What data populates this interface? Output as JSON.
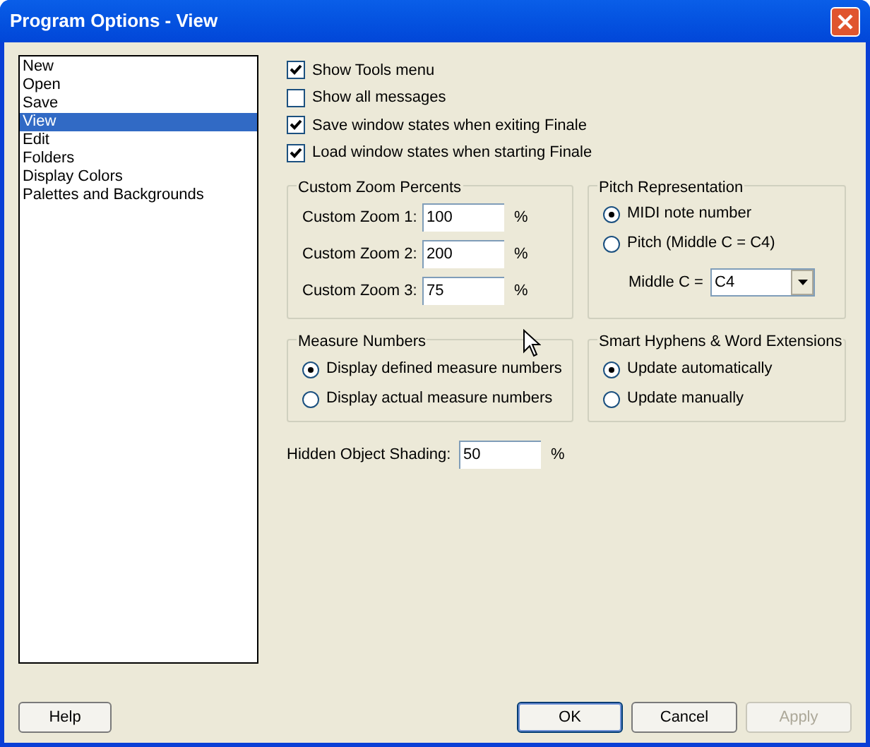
{
  "window": {
    "title": "Program Options - View"
  },
  "list": {
    "items": [
      {
        "label": "New",
        "selected": false
      },
      {
        "label": "Open",
        "selected": false
      },
      {
        "label": "Save",
        "selected": false
      },
      {
        "label": "View",
        "selected": true
      },
      {
        "label": "Edit",
        "selected": false
      },
      {
        "label": "Folders",
        "selected": false
      },
      {
        "label": "Display Colors",
        "selected": false
      },
      {
        "label": "Palettes and Backgrounds",
        "selected": false
      }
    ]
  },
  "checkboxes": [
    {
      "label": "Show Tools menu",
      "checked": true
    },
    {
      "label": "Show all messages",
      "checked": false
    },
    {
      "label": "Save window states when exiting Finale",
      "checked": true
    },
    {
      "label": "Load window states when starting Finale",
      "checked": true
    }
  ],
  "custom_zoom": {
    "title": "Custom Zoom Percents",
    "rows": [
      {
        "label": "Custom Zoom 1:",
        "value": "100",
        "unit": "%"
      },
      {
        "label": "Custom Zoom 2:",
        "value": "200",
        "unit": "%"
      },
      {
        "label": "Custom Zoom 3:",
        "value": "75",
        "unit": "%"
      }
    ]
  },
  "pitch_representation": {
    "title": "Pitch Representation",
    "options": [
      {
        "label": "MIDI note number",
        "selected": true
      },
      {
        "label": "Pitch (Middle C = C4)",
        "selected": false
      }
    ],
    "middle_c": {
      "label": "Middle C =",
      "value": "C4"
    }
  },
  "measure_numbers": {
    "title": "Measure Numbers",
    "options": [
      {
        "label": "Display defined measure numbers",
        "selected": true
      },
      {
        "label": "Display actual measure numbers",
        "selected": false
      }
    ]
  },
  "smart_hyphens": {
    "title": "Smart Hyphens & Word Extensions",
    "options": [
      {
        "label": "Update automatically",
        "selected": true
      },
      {
        "label": "Update manually",
        "selected": false
      }
    ]
  },
  "hidden_object_shading": {
    "label": "Hidden Object Shading:",
    "value": "50",
    "unit": "%"
  },
  "buttons": [
    {
      "label": "Help",
      "kind": "normal",
      "disabled": false
    },
    {
      "label": "OK",
      "kind": "default",
      "disabled": false
    },
    {
      "label": "Cancel",
      "kind": "normal",
      "disabled": false
    },
    {
      "label": "Apply",
      "kind": "normal",
      "disabled": true
    }
  ]
}
